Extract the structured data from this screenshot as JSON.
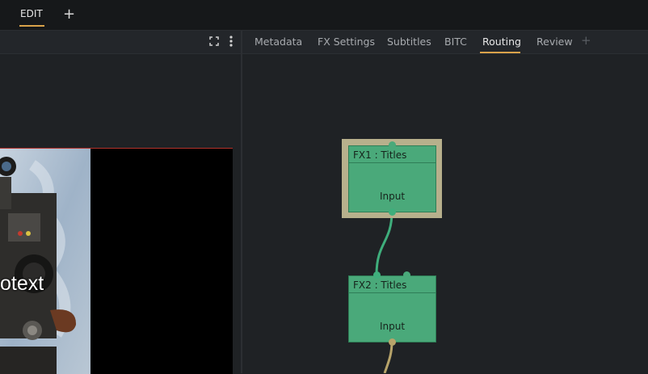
{
  "topbar": {
    "tab": "EDIT",
    "add": "+"
  },
  "tabs": [
    {
      "label": "Metadata"
    },
    {
      "label": "FX Settings"
    },
    {
      "label": "Subtitles"
    },
    {
      "label": "BITC"
    },
    {
      "label": "Routing",
      "active": true
    },
    {
      "label": "Review"
    }
  ],
  "tabs_add": "+",
  "viewer": {
    "overlay_text": "otext"
  },
  "nodes": [
    {
      "title": "FX1 : Titles",
      "input_label": "Input"
    },
    {
      "title": "FX2 : Titles",
      "input_label": "Input"
    }
  ],
  "colors": {
    "accent": "#d9a24a",
    "node_fill": "#4aa97a",
    "node_selected_outline": "#b7b08c",
    "wire_green": "#3fae7c",
    "wire_yellow": "#b7a46a",
    "viewer_border": "#b3322b"
  }
}
